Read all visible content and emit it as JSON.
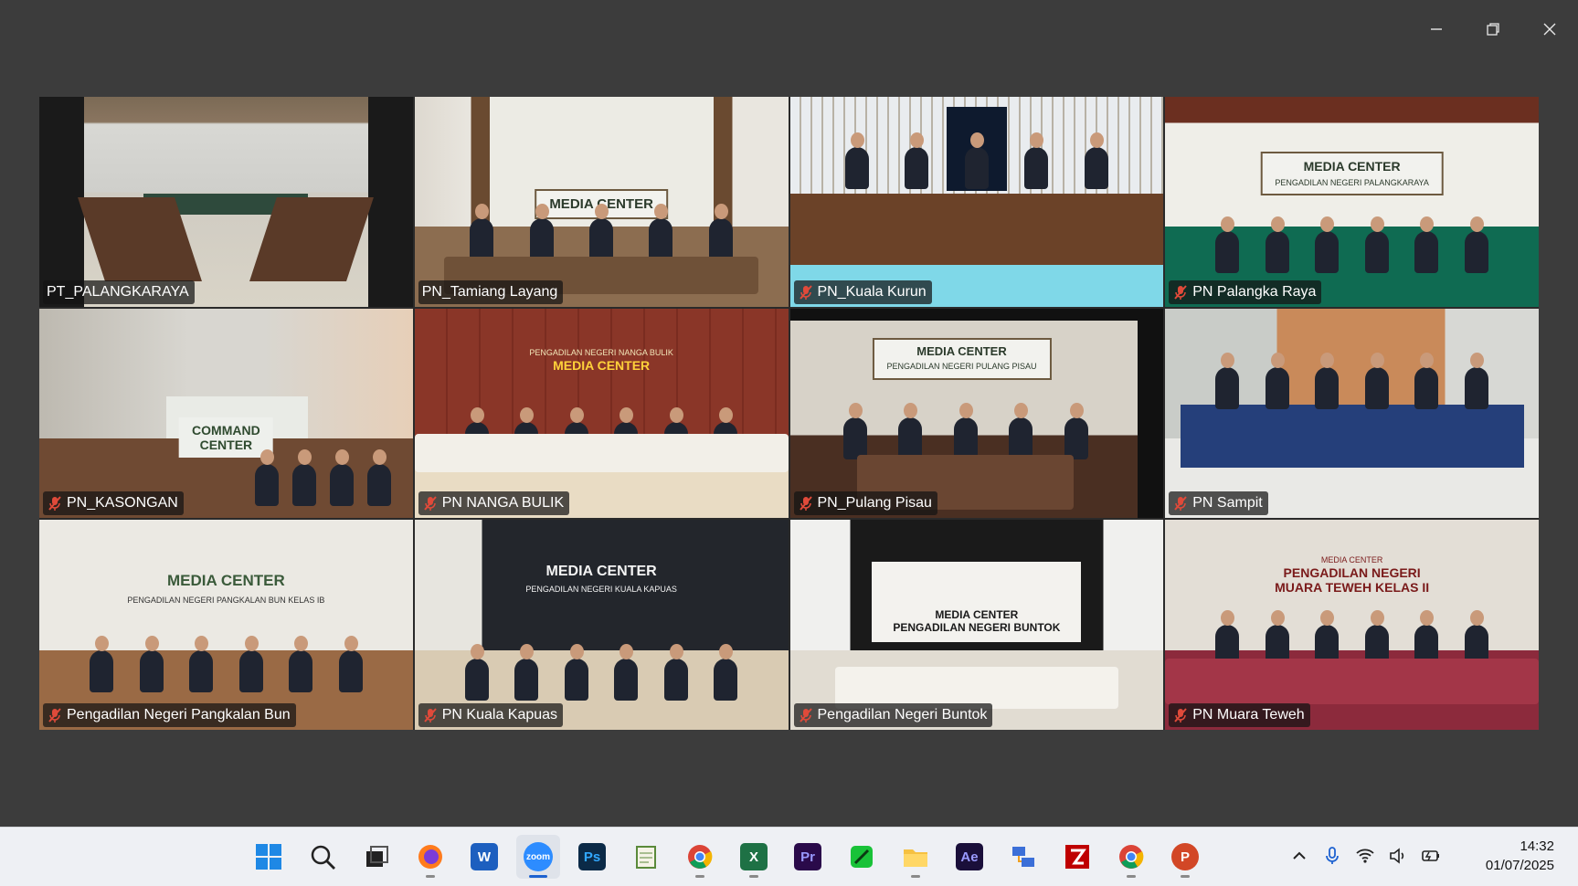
{
  "window": {
    "minimize_icon": "minimize-icon",
    "restore_icon": "restore-icon",
    "close_icon": "close-icon"
  },
  "meeting": {
    "tiles": [
      {
        "name": "PT_PALANGKARAYA",
        "muted": false,
        "active": true
      },
      {
        "name": "PN_Tamiang Layang",
        "muted": false
      },
      {
        "name": "PN_Kuala Kurun",
        "muted": true
      },
      {
        "name": "PN Palangka Raya",
        "muted": true
      },
      {
        "name": "PN_KASONGAN",
        "muted": true
      },
      {
        "name": "PN NANGA BULIK",
        "muted": true
      },
      {
        "name": "PN_Pulang Pisau",
        "muted": true
      },
      {
        "name": "PN Sampit",
        "muted": true
      },
      {
        "name": "Pengadilan Negeri Pangkalan Bun",
        "muted": true
      },
      {
        "name": "PN Kuala Kapuas",
        "muted": true
      },
      {
        "name": "Pengadilan Negeri Buntok",
        "muted": true
      },
      {
        "name": "PN Muara Teweh",
        "muted": true
      }
    ],
    "signs": {
      "s1": "MEDIA CENTER",
      "s2": "MEDIA CENTER",
      "s3": "MEDIA CENTER",
      "s3b": "PENGADILAN NEGERI PALANGKARAYA",
      "s4": "COMMAND",
      "s4b": "CENTER",
      "s5a": "PENGADILAN NEGERI NANGA BULIK",
      "s5": "MEDIA CENTER",
      "s6": "MEDIA CENTER",
      "s6b": "PENGADILAN NEGERI PULANG PISAU",
      "s7": "MEDIA CENTER",
      "s7b": "PENGADILAN NEGERI PANGKALAN BUN KELAS IB",
      "s8": "MEDIA CENTER",
      "s8b": "PENGADILAN NEGERI KUALA KAPUAS",
      "s9": "MEDIA   CENTER",
      "s9b": "PENGADILAN  NEGERI  BUNTOK",
      "s10": "MEDIA CENTER",
      "s10b": "PENGADILAN NEGERI",
      "s10c": "MUARA TEWEH KELAS II"
    }
  },
  "taskbar": {
    "apps": [
      "start-icon",
      "search-icon",
      "task-view-icon",
      "firefox-icon",
      "word-icon",
      "zoom-icon",
      "photoshop-icon",
      "notepad-icon",
      "chrome-icon",
      "excel-icon",
      "premiere-icon",
      "app-icon",
      "file-explorer-icon",
      "after-effects-icon",
      "network-icon",
      "filezilla-icon",
      "chrome-icon",
      "powerpoint-icon"
    ],
    "labels": {
      "word": "W",
      "zoom": "zoom",
      "ps": "Ps",
      "excel": "X",
      "pr": "Pr",
      "ae": "Ae",
      "pp": "P"
    },
    "time": "14:32",
    "date": "01/07/2025"
  },
  "colors": {
    "accent": "#23d18b",
    "muted": "#e04a3a",
    "taskbar": "#eef0f4"
  }
}
